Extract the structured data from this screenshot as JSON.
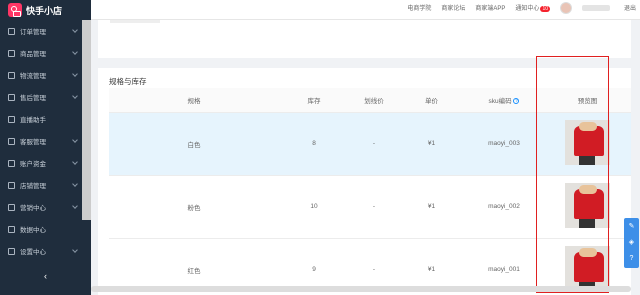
{
  "app": {
    "name": "快手小店"
  },
  "sidebar": {
    "items": [
      {
        "label": "订单管理",
        "arrow": true
      },
      {
        "label": "商品管理",
        "arrow": true
      },
      {
        "label": "物流管理",
        "arrow": true
      },
      {
        "label": "售后管理",
        "arrow": true
      },
      {
        "label": "直播助手",
        "arrow": false
      },
      {
        "label": "客服管理",
        "arrow": true
      },
      {
        "label": "账户资金",
        "arrow": true
      },
      {
        "label": "店铺管理",
        "arrow": true
      },
      {
        "label": "营销中心",
        "arrow": true
      },
      {
        "label": "数据中心",
        "arrow": false
      },
      {
        "label": "设置中心",
        "arrow": true
      }
    ],
    "collapse": "‹"
  },
  "topbar": {
    "links": [
      "电商学院",
      "商家论坛",
      "商家端APP"
    ],
    "notice": "通知中心",
    "notice_count": "10",
    "right_text": "退出"
  },
  "section": {
    "title": "规格与库存"
  },
  "table": {
    "headers": [
      "规格",
      "库存",
      "划线价",
      "单价",
      "sku编码",
      "预览图"
    ],
    "help": "?",
    "rows": [
      {
        "spec": "白色",
        "stock": "8",
        "strike": "-",
        "price": "¥1",
        "sku": "maoyi_003"
      },
      {
        "spec": "粉色",
        "stock": "10",
        "strike": "-",
        "price": "¥1",
        "sku": "maoyi_002"
      },
      {
        "spec": "红色",
        "stock": "9",
        "strike": "-",
        "price": "¥1",
        "sku": "maoyi_001"
      }
    ]
  },
  "float": [
    "✎",
    "◈",
    "?"
  ],
  "colors": {
    "sidebar": "#1f2d3d",
    "accent": "#1890ff",
    "highlight": "#e02020",
    "row_hl": "#e6f4fd"
  }
}
